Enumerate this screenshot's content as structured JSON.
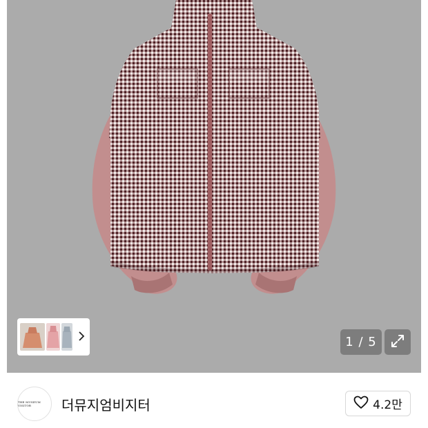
{
  "product_viewer": {
    "image_alt": "checkered hooded zip jacket",
    "image_index": "1 / 5",
    "thumbnail_count": 3
  },
  "seller": {
    "logo_text": "THE MUSEUM VISITOR",
    "name": "더뮤지엄비지터"
  },
  "like": {
    "count": "4.2만"
  },
  "icons": {
    "expand": "expand-icon",
    "heart": "heart-icon",
    "chevron": "chevron-right-icon"
  },
  "colors": {
    "backdrop": "#ababab",
    "check_dark": "#5a2a2e",
    "sleeve": "#bf8b8b"
  }
}
